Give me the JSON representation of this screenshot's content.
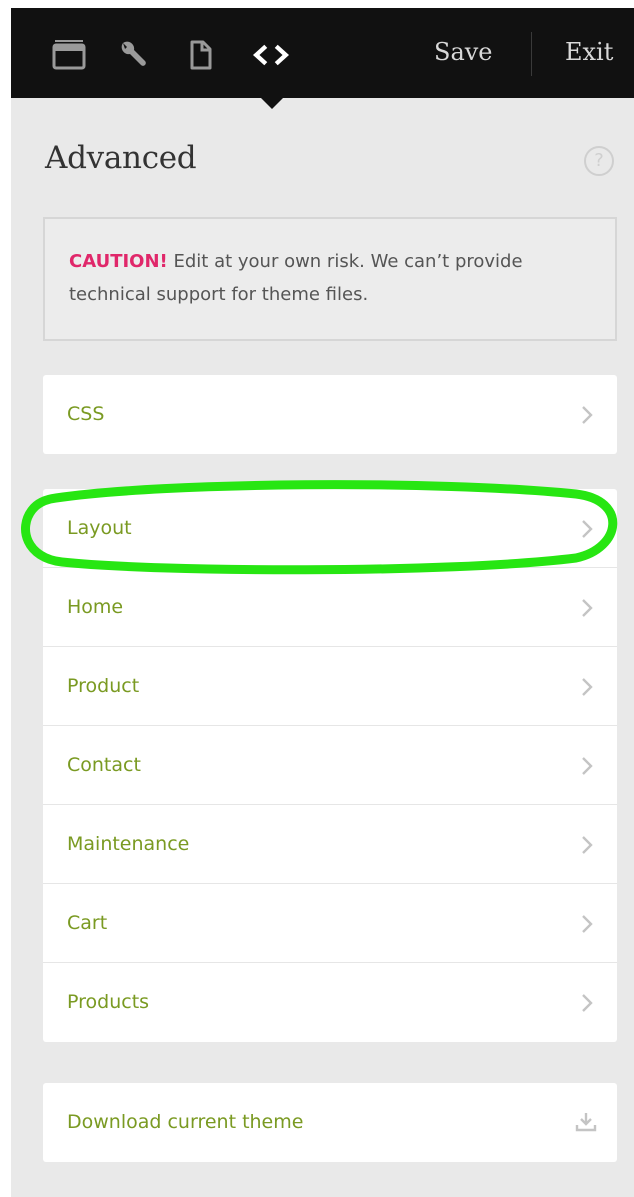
{
  "toolbar": {
    "icons": [
      "window-icon",
      "wrench-icon",
      "file-icon",
      "code-icon"
    ],
    "save_label": "Save",
    "exit_label": "Exit"
  },
  "panel": {
    "title": "Advanced",
    "help_label": "?"
  },
  "caution": {
    "label": "CAUTION!",
    "text": " Edit at your own risk. We can’t provide technical support for theme files."
  },
  "css_item": {
    "label": "CSS"
  },
  "templates": [
    {
      "label": "Layout"
    },
    {
      "label": "Home"
    },
    {
      "label": "Product"
    },
    {
      "label": "Contact"
    },
    {
      "label": "Maintenance"
    },
    {
      "label": "Cart"
    },
    {
      "label": "Products"
    }
  ],
  "download": {
    "label": "Download current theme"
  },
  "colors": {
    "accent_green": "#7a9a22",
    "caution_red": "#e0276a",
    "highlight_green": "#27e612",
    "topbar": "#111111"
  }
}
